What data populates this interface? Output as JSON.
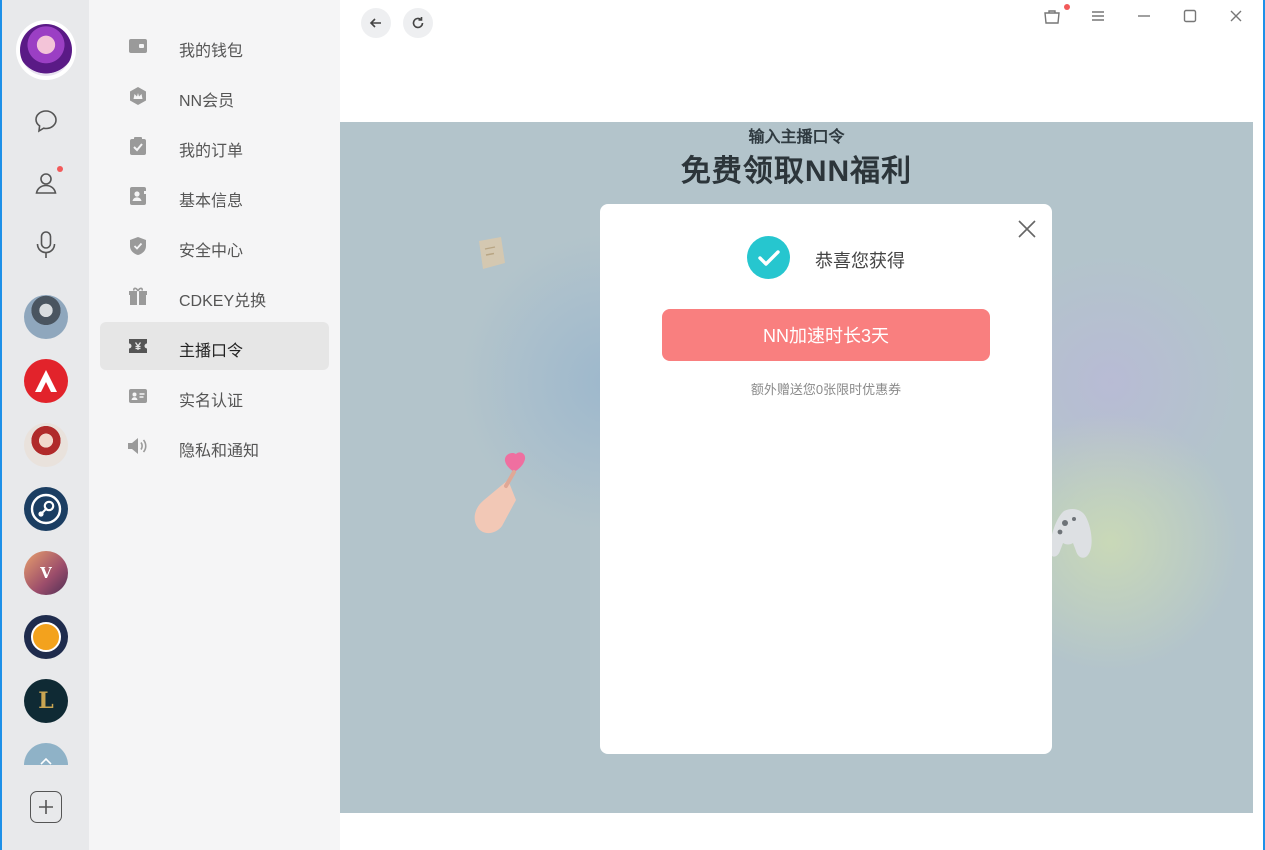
{
  "menu": {
    "items": [
      {
        "label": "我的钱包",
        "icon": "wallet-icon"
      },
      {
        "label": "NN会员",
        "icon": "crown-icon"
      },
      {
        "label": "我的订单",
        "icon": "clipboard-check-icon"
      },
      {
        "label": "基本信息",
        "icon": "id-book-icon"
      },
      {
        "label": "安全中心",
        "icon": "shield-check-icon"
      },
      {
        "label": "CDKEY兑换",
        "icon": "gift-icon"
      },
      {
        "label": "主播口令",
        "icon": "yen-ticket-icon"
      },
      {
        "label": "实名认证",
        "icon": "id-card-icon"
      },
      {
        "label": "隐私和通知",
        "icon": "speaker-icon"
      }
    ],
    "active_label": "主播口令"
  },
  "rail": {
    "icons": [
      "chat-bubble-icon",
      "user-icon",
      "microphone-icon"
    ],
    "games": [
      "pubg-game-icon",
      "apex-game-icon",
      "naraka-game-icon",
      "steam-game-icon",
      "gta5-game-icon",
      "csgo-game-icon",
      "lol-game-icon",
      "more-game-icon"
    ],
    "add_icon": "plus-square-icon"
  },
  "banner": {
    "subtitle": "输入主播口令",
    "title": "免费领取NN福利"
  },
  "modal": {
    "congrats": "恭喜您获得",
    "reward": "NN加速时长3天",
    "note": "额外赠送您0张限时优惠券"
  },
  "colors": {
    "accent_red": "#f97f7f",
    "check_teal": "#26c6cf",
    "banner_bg": "#b3c4cb",
    "frame_blue": "#1e90e8",
    "notify_dot": "#f25a5a"
  }
}
